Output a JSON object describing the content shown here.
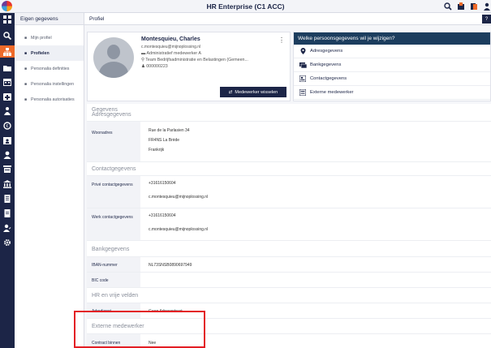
{
  "app": {
    "title": "HR Enterprise (C1 ACC)"
  },
  "nav": {
    "header": "Eigen gegevens",
    "items": [
      {
        "label": "Mijn profiel",
        "active": false
      },
      {
        "label": "Profielen",
        "active": true
      },
      {
        "label": "Personalia definities",
        "active": false
      },
      {
        "label": "Personalia instellingen",
        "active": false
      },
      {
        "label": "Personalia autorisaties",
        "active": false
      }
    ]
  },
  "page": {
    "title": "Profiel"
  },
  "profile": {
    "name": "Montesquieu, Charles",
    "email": "c.montesquieu@mijnoplossing.nl",
    "role": "Administratief medewerker A",
    "team": "Team Bedrijfsadministratie en Belastingen (Gemeen...",
    "employee_number": "000000223",
    "switch_button": "Medewerker wisselen"
  },
  "change_panel": {
    "title": "Welke persoonsgegevens wil je wijzigen?",
    "items": [
      "Adresgegevens",
      "Bankgegevens",
      "Contactgegevens",
      "Externe medewerker"
    ]
  },
  "details": {
    "section_title": "Gegevens",
    "address": {
      "title": "Adresgegevens",
      "label": "Woonadres",
      "lines": [
        "Rue de la Parlasien 34",
        "FR4NS La Brède",
        "Frankrijk"
      ]
    },
    "contact": {
      "title": "Contactgegevens",
      "private_label": "Privé contactgegevens",
      "private_lines": [
        "+31616150604",
        "c.montesquieu@mijnoplossing.nl"
      ],
      "work_label": "Werk contactgegevens",
      "work_lines": [
        "+31616150604",
        "c.montesquieu@mijnoplossing.nl"
      ]
    },
    "bank": {
      "title": "Bankgegevens",
      "iban_label": "IBAN-nummer",
      "iban_value": "NL73SNSB0890697949",
      "bic_label": "BIC code",
      "bic_value": ""
    },
    "hr": {
      "title": "HR en vrije velden",
      "label": "Arbodienst",
      "value": "Geen Arbocontract"
    },
    "external": {
      "title": "Externe medewerker",
      "label": "Contract binnen",
      "value": "Nee"
    }
  },
  "colors": {
    "navy": "#1c2547",
    "accent": "#ee6a2a",
    "highlight": "#e31e24",
    "panel_header": "#1c3d5e"
  },
  "rail_icons": [
    "grid-icon",
    "search-icon",
    "org-chart-icon",
    "folder-icon",
    "calendar-icon",
    "medical-icon",
    "person-money-icon",
    "clock-money-icon",
    "calendar-person-icon",
    "user-icon",
    "id-card-icon",
    "building-icon",
    "document-icon",
    "document-list-icon",
    "user-edit-icon",
    "settings-gear-icon"
  ]
}
